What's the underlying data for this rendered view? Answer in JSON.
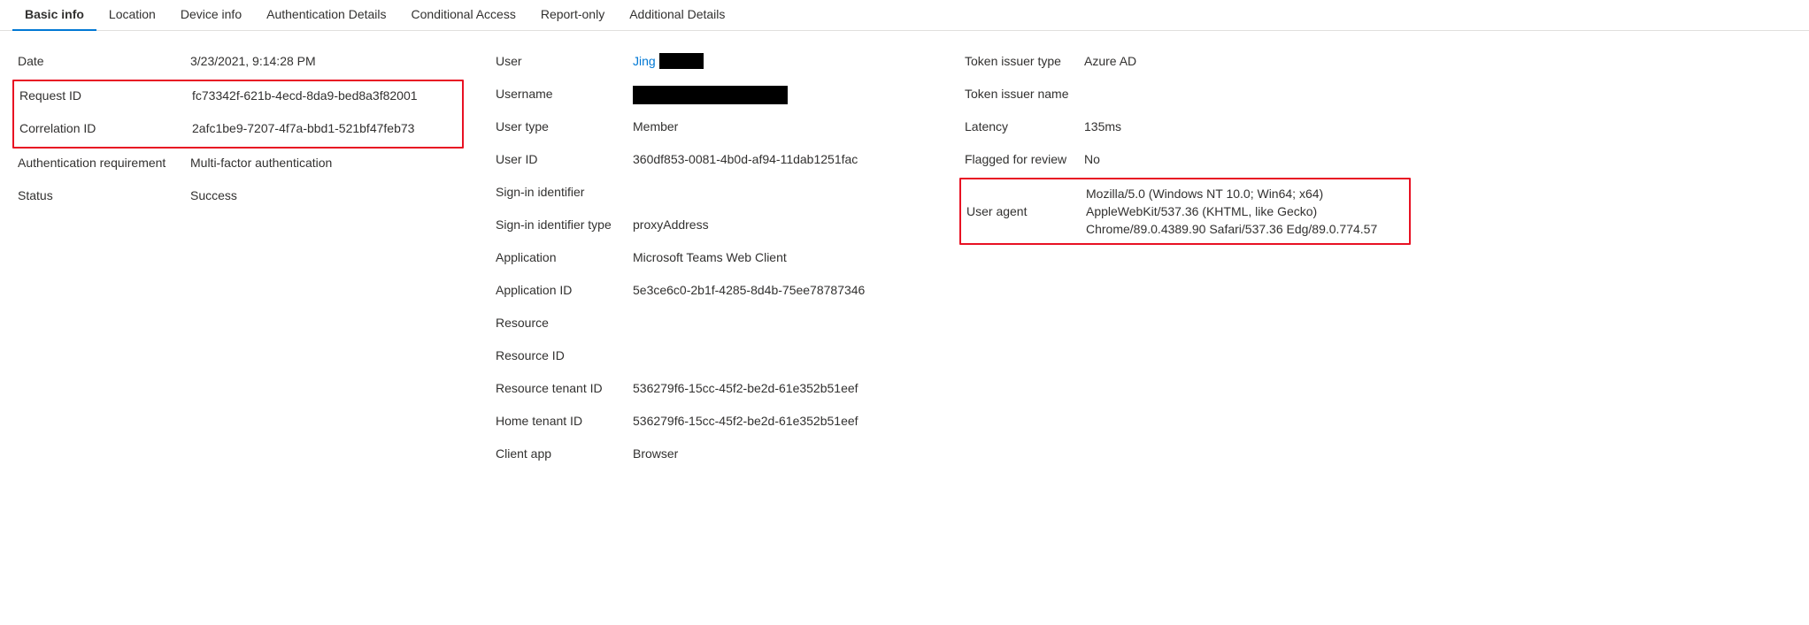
{
  "tabs": {
    "basic_info": "Basic info",
    "location": "Location",
    "device_info": "Device info",
    "authentication_details": "Authentication Details",
    "conditional_access": "Conditional Access",
    "report_only": "Report-only",
    "additional_details": "Additional Details"
  },
  "column1": {
    "date": {
      "label": "Date",
      "value": "3/23/2021, 9:14:28 PM"
    },
    "request_id": {
      "label": "Request ID",
      "value": "fc73342f-621b-4ecd-8da9-bed8a3f82001"
    },
    "correlation_id": {
      "label": "Correlation ID",
      "value": "2afc1be9-7207-4f7a-bbd1-521bf47feb73"
    },
    "auth_requirement": {
      "label": "Authentication requirement",
      "value": "Multi-factor authentication"
    },
    "status": {
      "label": "Status",
      "value": "Success"
    }
  },
  "column2": {
    "user": {
      "label": "User",
      "value": "Jing"
    },
    "username": {
      "label": "Username",
      "value": ""
    },
    "user_type": {
      "label": "User type",
      "value": "Member"
    },
    "user_id": {
      "label": "User ID",
      "value": "360df853-0081-4b0d-af94-11dab1251fac"
    },
    "signin_identifier": {
      "label": "Sign-in identifier",
      "value": ""
    },
    "signin_identifier_type": {
      "label": "Sign-in identifier type",
      "value": "proxyAddress"
    },
    "application": {
      "label": "Application",
      "value": "Microsoft Teams Web Client"
    },
    "application_id": {
      "label": "Application ID",
      "value": "5e3ce6c0-2b1f-4285-8d4b-75ee78787346"
    },
    "resource": {
      "label": "Resource",
      "value": ""
    },
    "resource_id": {
      "label": "Resource ID",
      "value": ""
    },
    "resource_tenant_id": {
      "label": "Resource tenant ID",
      "value": "536279f6-15cc-45f2-be2d-61e352b51eef"
    },
    "home_tenant_id": {
      "label": "Home tenant ID",
      "value": "536279f6-15cc-45f2-be2d-61e352b51eef"
    },
    "client_app": {
      "label": "Client app",
      "value": "Browser"
    }
  },
  "column3": {
    "token_issuer_type": {
      "label": "Token issuer type",
      "value": "Azure AD"
    },
    "token_issuer_name": {
      "label": "Token issuer name",
      "value": ""
    },
    "latency": {
      "label": "Latency",
      "value": "135ms"
    },
    "flagged_for_review": {
      "label": "Flagged for review",
      "value": "No"
    },
    "user_agent": {
      "label": "User agent",
      "value": "Mozilla/5.0 (Windows NT 10.0; Win64; x64) AppleWebKit/537.36 (KHTML, like Gecko) Chrome/89.0.4389.90 Safari/537.36 Edg/89.0.774.57"
    }
  }
}
